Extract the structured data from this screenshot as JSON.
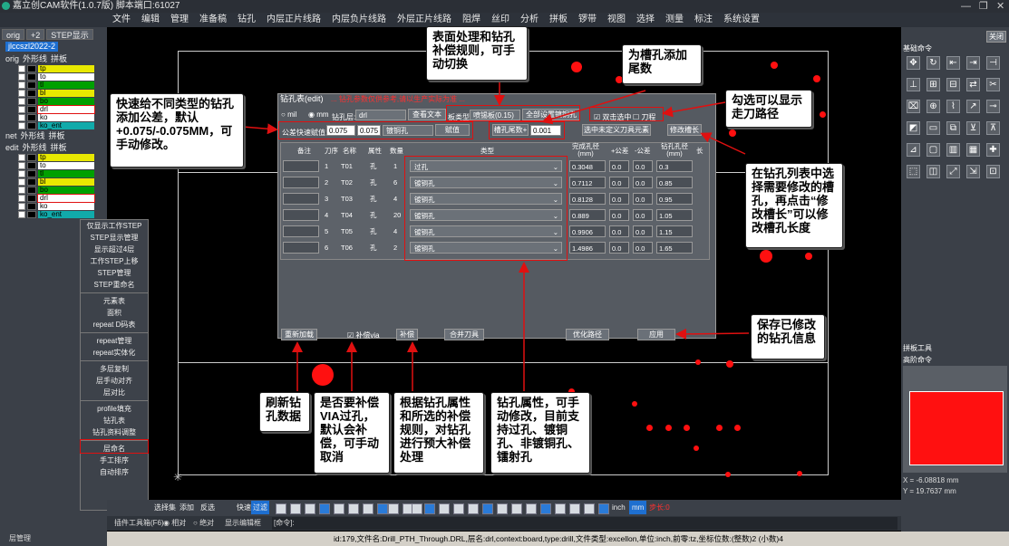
{
  "title": "嘉立创CAM软件(1.0.7版) 脚本端口:61027",
  "menu": [
    "文件",
    "编辑",
    "管理",
    "准备稿",
    "钻孔",
    "内层正片线路",
    "内层负片线路",
    "外层正片线路",
    "阻焊",
    "丝印",
    "分析",
    "拼板",
    "锣带",
    "视图",
    "选择",
    "测量",
    "标注",
    "系统设置"
  ],
  "left": {
    "tabs": [
      "orig",
      "+2",
      "STEP显示"
    ],
    "job": "jlccszl2022-2",
    "orig_group": "orig",
    "shape_label": "外形线",
    "panel_label": "拼板",
    "orig_layers": [
      "tp",
      "to",
      "tl",
      "bl",
      "bo",
      "drl",
      "ko",
      "ko_ent"
    ],
    "net_group": "net",
    "edit_group": "edit",
    "edit_layers": [
      "tp",
      "to",
      "tl",
      "bl",
      "bo",
      "drl",
      "ko",
      "ko_ent"
    ],
    "footer": "层管理"
  },
  "context_menu": [
    "仅显示工作STEP",
    "STEP显示管理",
    "显示超过4层",
    "工作STEP上移",
    "STEP管理",
    "STEP重命名",
    "元素表",
    "面积",
    "repeat D码表",
    "repeat管理",
    "repeat实体化",
    "多层复制",
    "层手动对齐",
    "层对比",
    "profile填充",
    "钻孔表",
    "钻孔资料调整",
    "层命名",
    "手工排序",
    "自动排序"
  ],
  "drill": {
    "title": "钻孔表(edit)",
    "warning": "... 钻孔参数仅供参考,请以生产实际为准 ...",
    "unit_mil": "mil",
    "unit_mm": "mm",
    "layer_label": "钻孔层:",
    "layer_value": "drl",
    "view_btn": "查看文本",
    "board_type_label": "板类型",
    "board_type_value": "喷锡板(0.15)",
    "set_all_btn": "全部设置镀铜孔",
    "dbl_click_label": "双击选中",
    "knife_label": "刀程",
    "tol_label": "公差快速赋值:",
    "tol_plus": "0.075",
    "tol_minus": "0.075",
    "tol_type": "镀铜孔",
    "assign_btn": "赋值",
    "slot_label": "槽孔尾数+",
    "slot_value": "0.001",
    "select_undef_btn": "选中未定义刀具元素",
    "edit_slot_btn": "修改槽长",
    "headers": [
      "备注",
      "刀序",
      "名称",
      "属性",
      "数量",
      "类型",
      "完成孔径(mm)",
      "+公差",
      "-公差",
      "钻孔孔径(mm)",
      "长"
    ],
    "rows": [
      [
        "",
        "1",
        "T01",
        "孔",
        "1",
        "过孔",
        "0.3048",
        "0.0",
        "0.0",
        "0.3"
      ],
      [
        "",
        "2",
        "T02",
        "孔",
        "6",
        "镀铜孔",
        "0.7112",
        "0.0",
        "0.0",
        "0.85"
      ],
      [
        "",
        "3",
        "T03",
        "孔",
        "4",
        "镀铜孔",
        "0.8128",
        "0.0",
        "0.0",
        "0.95"
      ],
      [
        "",
        "4",
        "T04",
        "孔",
        "20",
        "镀铜孔",
        "0.889",
        "0.0",
        "0.0",
        "1.05"
      ],
      [
        "",
        "5",
        "T05",
        "孔",
        "4",
        "镀铜孔",
        "0.9906",
        "0.0",
        "0.0",
        "1.15"
      ],
      [
        "",
        "6",
        "T06",
        "孔",
        "2",
        "镀铜孔",
        "1.4986",
        "0.0",
        "0.0",
        "1.65"
      ]
    ],
    "reload_btn": "重新加载",
    "comp_via_label": "补偿via",
    "comp_btn": "补偿",
    "merge_btn": "合并刀具",
    "optimize_btn": "优化路径",
    "apply_btn": "应用"
  },
  "callouts": {
    "c1": "快速给不同类型的钻孔添加公差，默认+0.075/-0.075MM，可手动修改。",
    "c2": "表面处理和钻孔补偿规则，可手动切换",
    "c3": "为槽孔添加尾数",
    "c4": "勾选可以显示走刀路径",
    "c5": "在钻孔列表中选择需要修改的槽孔，再点击“修改槽长”可以修改槽孔长度",
    "c6": "保存已修改的钻孔信息",
    "c7": "刷新钻孔数据",
    "c8": "是否要补偿VIA过孔，默认会补偿，可手动取消",
    "c9": "根据钻孔属性和所选的补偿规则，对钻孔进行预大补偿处理",
    "c10": "钻孔属性，可手动修改，目前支持过孔、镀铜孔、非镀铜孔、镭射孔"
  },
  "right": {
    "close": "关闭",
    "basic_cmds": "基础命令",
    "panel_tools": "拼板工具",
    "advanced_cmds": "高阶命令",
    "coord_x": "X = -6.08818 mm",
    "coord_y": "Y = 19.7637 mm"
  },
  "bottom": {
    "select_all": "选择集",
    "add": "添加",
    "invert": "反选",
    "fast": "快速",
    "filter": "过滤",
    "inch": "inch",
    "mm": "mm",
    "step": "步长:0",
    "plugin": "插件工具箱(F6)",
    "relative": "相对",
    "absolute": "绝对",
    "show_edit": "显示编辑框",
    "cmd": "[命令]:"
  },
  "status": "id:179,文件名:Drill_PTH_Through.DRL,层名:drl,context:board,type:drill,文件类型:excellon,单位:inch,前零:tz,坐标位数:(整数)2 (小数)4"
}
